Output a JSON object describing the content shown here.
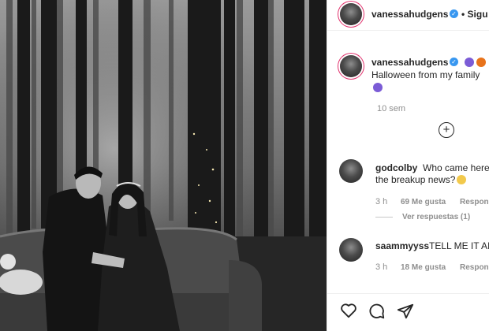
{
  "post": {
    "header_username": "vanessahudgens",
    "follow_label": "• Sigu",
    "caption_username": "vanessahudgens",
    "caption_text": "Halloween from my family",
    "time_ago": "10 sem"
  },
  "comments": [
    {
      "username": "godcolby",
      "text_line1": "Who came here",
      "text_line2": "the breakup news?",
      "time": "3 h",
      "likes": "69 Me gusta",
      "reply": "Respon",
      "view_replies": "Ver respuestas (1)"
    },
    {
      "username": "saammyyss",
      "text_line1": "TELL ME IT AIN",
      "time": "3 h",
      "likes": "18 Me gusta",
      "reply": "Respon"
    }
  ],
  "colors": {
    "verified": "#3897f0",
    "story_ring": "#e1306c",
    "emoji_purple": "#7b5cd6",
    "emoji_orange": "#e8731b"
  },
  "icons": [
    "heart-icon",
    "comment-icon",
    "share-icon",
    "add-comment-icon",
    "verified-icon"
  ]
}
